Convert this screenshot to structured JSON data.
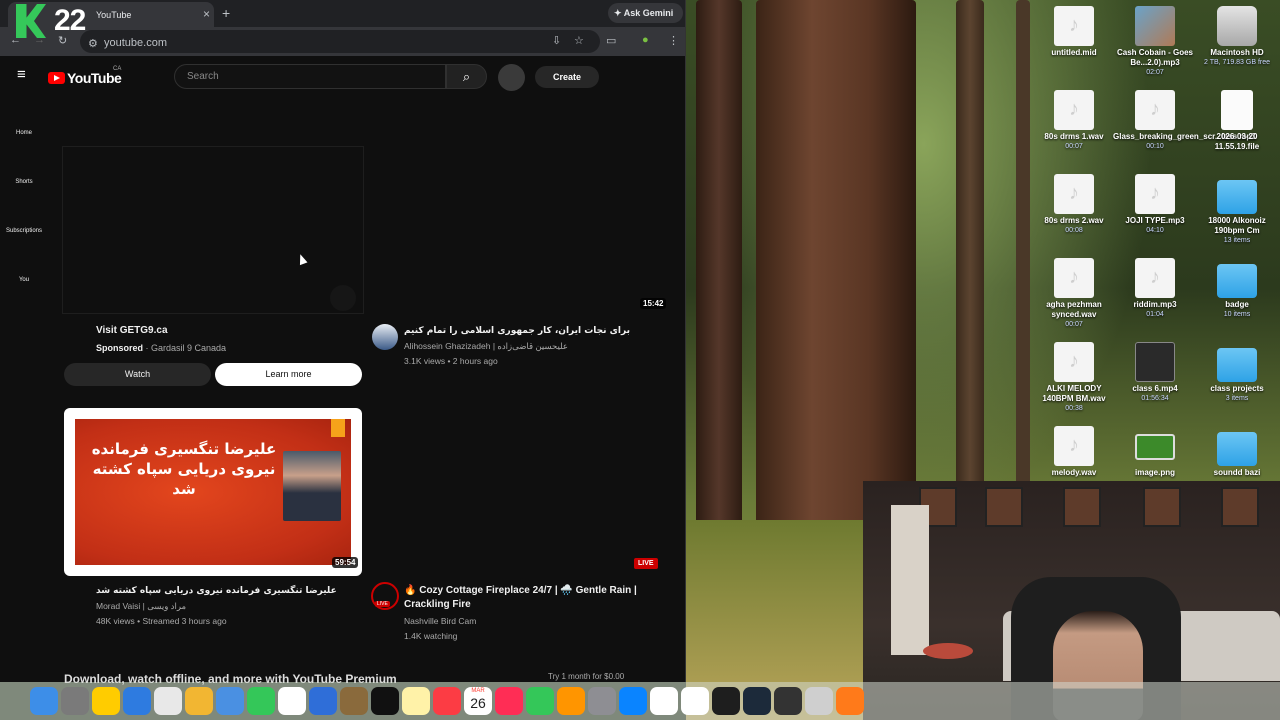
{
  "overlay": {
    "channel_badge": "22"
  },
  "browser": {
    "tab_title": "YouTube",
    "tab_close": "×",
    "new_tab": "+",
    "gemini_label": "Ask Gemini",
    "url": "youtube.com"
  },
  "youtube": {
    "logo_text": "YouTube",
    "country_code": "CA",
    "search_placeholder": "Search",
    "create_label": "Create",
    "sidebar": [
      {
        "label": "Home"
      },
      {
        "label": "Shorts"
      },
      {
        "label": "Subscriptions"
      },
      {
        "label": "You"
      }
    ],
    "ad": {
      "title": "Visit GETG9.ca",
      "sponsored": "Sponsored",
      "advertiser": " · Gardasil 9 Canada",
      "watch_label": "Watch",
      "learn_label": "Learn more"
    },
    "videos": [
      {
        "duration": "15:42",
        "title": "برای نجات ایران، کار جمهوری اسلامی را تمام کنیم",
        "channel": "Alihossein Ghazizadeh | علیحسین قاضی‌زاده",
        "stats": "3.1K views • 2 hours ago"
      },
      {
        "duration": "59:54",
        "thumb_text": "علیرضا تنگسیری فرمانده نیروی دریایی سپاه کشته شد",
        "title": "علیرضا تنگسیری فرمانده نیروی دریایی سپاه کشته شد",
        "channel": "Morad Vaisi | مراد ویسی",
        "stats": "48K views • Streamed 3 hours ago"
      },
      {
        "badge": "LIVE",
        "avatar_badge": "LIVE",
        "title": "🔥 Cozy Cottage Fireplace 24/7 | 🌧️ Gentle Rain | Crackling Fire",
        "channel": "Nashville Bird Cam",
        "stats": "1.4K watching"
      }
    ],
    "promo_text": "Download, watch offline, and more with YouTube Premium",
    "promo_right": "Try 1 month for $0.00"
  },
  "desktop": {
    "icons": [
      {
        "name": "untitled.mid",
        "meta": "",
        "kind": "file"
      },
      {
        "name": "Cash Cobain - Goes Be...2.0).mp3",
        "meta": "02:07",
        "kind": "img"
      },
      {
        "name": "Macintosh HD",
        "meta": "2 TB, 719.83 GB free",
        "kind": "disk"
      },
      {
        "name": "80s drms 1.wav",
        "meta": "00:07",
        "kind": "file"
      },
      {
        "name": "Glass_breaking_green_scr...lass.mp3",
        "meta": "00:10",
        "kind": "file"
      },
      {
        "name": "2026-03-20 11.55.19.file",
        "meta": "",
        "kind": "doc"
      },
      {
        "name": "80s drms 2.wav",
        "meta": "00:08",
        "kind": "file"
      },
      {
        "name": "JOJI TYPE.mp3",
        "meta": "04:10",
        "kind": "file"
      },
      {
        "name": "18000 Alkonoiz 190bpm Cm",
        "meta": "13 items",
        "kind": "folder"
      },
      {
        "name": "agha pezhman synced.wav",
        "meta": "00:07",
        "kind": "file"
      },
      {
        "name": "riddim.mp3",
        "meta": "01:04",
        "kind": "file"
      },
      {
        "name": "badge",
        "meta": "10 items",
        "kind": "folder"
      },
      {
        "name": "ALKI MELODY 140BPM BM.wav",
        "meta": "00:38",
        "kind": "file"
      },
      {
        "name": "class 6.mp4",
        "meta": "01:56:34",
        "kind": "vid"
      },
      {
        "name": "class projects",
        "meta": "3 items",
        "kind": "folder"
      },
      {
        "name": "melody.wav",
        "meta": "",
        "kind": "file"
      },
      {
        "name": "image.png",
        "meta": "",
        "kind": "png"
      },
      {
        "name": "soundd bazi",
        "meta": "",
        "kind": "folder"
      }
    ]
  },
  "dock": {
    "calendar_month": "MAR",
    "calendar_day": "26",
    "apps": [
      "finder-icon",
      "launchpad-icon",
      "xcode-tool-icon",
      "safari-icon",
      "chrome-icon",
      "photos-icon",
      "mail-icon",
      "facetime-icon",
      "reminders-icon",
      "freeform-icon",
      "archive-icon",
      "appletv-icon",
      "notes-icon",
      "music-icon",
      "calendar-icon",
      "news-icon",
      "numbers-icon",
      "pages-icon",
      "settings-icon",
      "appstore-icon",
      "notion-icon",
      "calendar2-icon",
      "vpn-icon",
      "logic-icon",
      "unity-icon",
      "screenshot-icon",
      "carrot-icon"
    ],
    "app_colors": [
      "#3d8ee8",
      "#7a7a7a",
      "#ffcc00",
      "#2e7be0",
      "#e8e8e8",
      "#f2b632",
      "#4a90e2",
      "#34c759",
      "#ffffff",
      "#2f6ed8",
      "#8a6a3c",
      "#111111",
      "#fff2a8",
      "#fc3c44",
      "#ffffff",
      "#ff2d55",
      "#34c759",
      "#ff9500",
      "#8e8e93",
      "#0a84ff",
      "#ffffff",
      "#ffffff",
      "#1e1e1e",
      "#1c2a3a",
      "#333333",
      "#cfcfcf",
      "#ff7a1a"
    ]
  }
}
